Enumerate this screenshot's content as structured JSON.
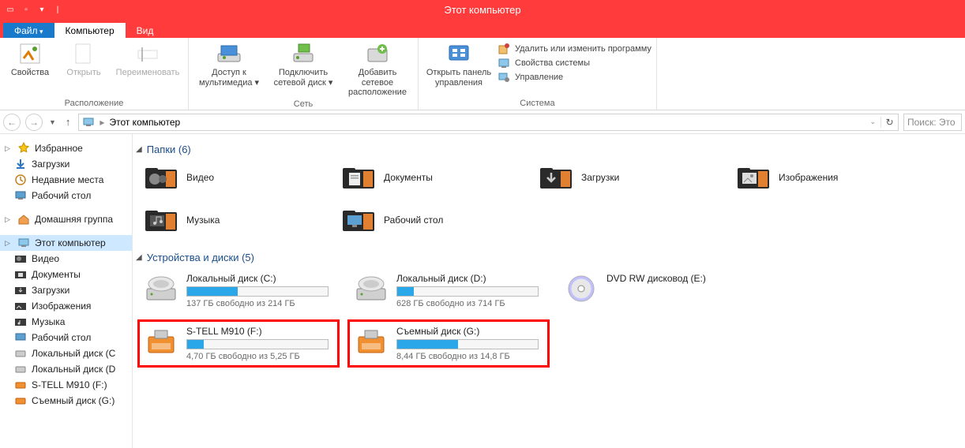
{
  "window": {
    "title": "Этот компьютер"
  },
  "tabs": {
    "file": "Файл",
    "computer": "Компьютер",
    "view": "Вид"
  },
  "ribbon": {
    "location": {
      "group": "Расположение",
      "properties": "Свойства",
      "open": "Открыть",
      "rename": "Переименовать"
    },
    "network": {
      "group": "Сеть",
      "media_l1": "Доступ к",
      "media_l2": "мультимедиа",
      "map_l1": "Подключить",
      "map_l2": "сетевой диск",
      "addloc_l1": "Добавить сетевое",
      "addloc_l2": "расположение"
    },
    "system": {
      "group": "Система",
      "cpanel_l1": "Открыть панель",
      "cpanel_l2": "управления",
      "uninstall": "Удалить или изменить программу",
      "sysprops": "Свойства системы",
      "manage": "Управление"
    }
  },
  "address": {
    "location": "Этот компьютер"
  },
  "search": {
    "placeholder": "Поиск: Это"
  },
  "sidebar": {
    "favorites": {
      "header": "Избранное",
      "items": [
        "Загрузки",
        "Недавние места",
        "Рабочий стол"
      ]
    },
    "homegroup": {
      "header": "Домашняя группа"
    },
    "computer": {
      "header": "Этот компьютер",
      "items": [
        "Видео",
        "Документы",
        "Загрузки",
        "Изображения",
        "Музыка",
        "Рабочий стол",
        "Локальный диск (C",
        "Локальный диск (D",
        "S-TELL M910 (F:)",
        "Съемный диск (G:)"
      ]
    }
  },
  "sections": {
    "folders": {
      "title": "Папки (6)"
    },
    "devices": {
      "title": "Устройства и диски (5)"
    }
  },
  "folders": [
    {
      "name": "Видео"
    },
    {
      "name": "Документы"
    },
    {
      "name": "Загрузки"
    },
    {
      "name": "Изображения"
    },
    {
      "name": "Музыка"
    },
    {
      "name": "Рабочий стол"
    }
  ],
  "drives": [
    {
      "name": "Локальный диск (C:)",
      "free": "137 ГБ свободно из 214 ГБ",
      "fill_pct": 36,
      "type": "hdd",
      "highlight": false
    },
    {
      "name": "Локальный диск (D:)",
      "free": "628 ГБ свободно из 714 ГБ",
      "fill_pct": 12,
      "type": "hdd",
      "highlight": false
    },
    {
      "name": "DVD RW дисковод (E:)",
      "free": "",
      "fill_pct": 0,
      "type": "dvd",
      "highlight": false
    },
    {
      "name": "S-TELL M910 (F:)",
      "free": "4,70 ГБ свободно из 5,25 ГБ",
      "fill_pct": 12,
      "type": "usb",
      "highlight": true
    },
    {
      "name": "Съемный диск (G:)",
      "free": "8,44 ГБ свободно из 14,8 ГБ",
      "fill_pct": 43,
      "type": "usb",
      "highlight": true
    }
  ]
}
